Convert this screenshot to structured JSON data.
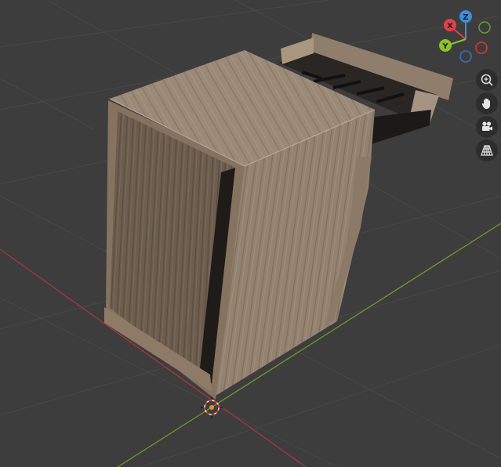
{
  "viewport": {
    "background": "#3d3d3d",
    "grid_color": "#484848",
    "x_axis_color": "#a8353f",
    "y_axis_color": "#6c9a2b",
    "object": "wooden-nightstand-with-open-drawer"
  },
  "gizmo": {
    "x_label": "X",
    "y_label": "Y",
    "z_label": "Z",
    "x_color": "#e0404a",
    "y_color": "#8cc22c",
    "z_color": "#3d8de0"
  },
  "nav_tools": [
    {
      "name": "zoom-icon",
      "icon": "magnifier-plus"
    },
    {
      "name": "pan-icon",
      "icon": "hand"
    },
    {
      "name": "camera-icon",
      "icon": "camera"
    },
    {
      "name": "perspective-icon",
      "icon": "grid-perspective"
    }
  ]
}
